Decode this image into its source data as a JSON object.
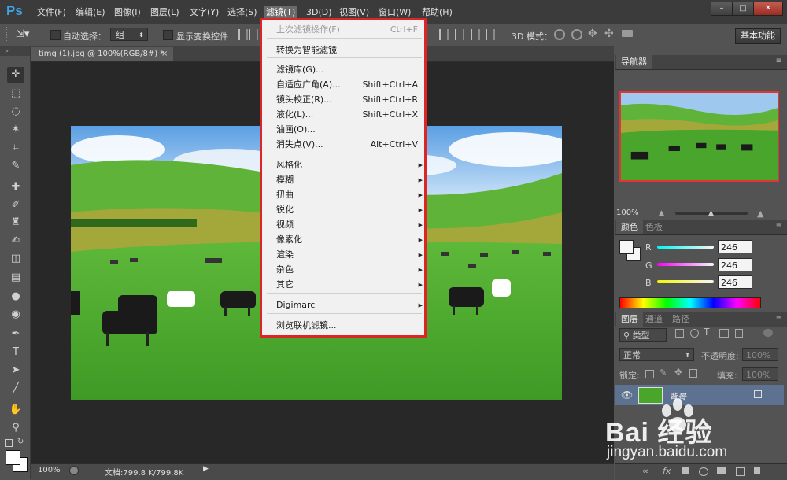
{
  "app": {
    "logo": "Ps"
  },
  "menubar": {
    "items": [
      "文件(F)",
      "编辑(E)",
      "图像(I)",
      "图层(L)",
      "文字(Y)",
      "选择(S)",
      "滤镜(T)",
      "3D(D)",
      "视图(V)",
      "窗口(W)",
      "帮助(H)"
    ],
    "active_index": 6
  },
  "window_controls": {
    "minimize": "–",
    "maximize": "□",
    "close": "✕"
  },
  "options_bar": {
    "auto_select_label": "自动选择：",
    "auto_select_value": "组",
    "show_transform_label": "显示变换控件",
    "mode_3d_label": "3D 模式：",
    "workspace_label": "基本功能"
  },
  "document": {
    "tab_title": "timg (1).jpg @ 100%(RGB/8#) *",
    "tab_close": "×"
  },
  "statusbar": {
    "zoom": "100%",
    "doc_info": "文档:799.8 K/799.8K"
  },
  "filter_menu": {
    "items": [
      {
        "label": "上次滤镜操作(F)",
        "shortcut": "Ctrl+F",
        "disabled": true
      },
      {
        "label": "转换为智能滤镜",
        "shortcut": ""
      },
      {
        "label": "滤镜库(G)...",
        "shortcut": ""
      },
      {
        "label": "自适应广角(A)...",
        "shortcut": "Shift+Ctrl+A"
      },
      {
        "label": "镜头校正(R)...",
        "shortcut": "Shift+Ctrl+R"
      },
      {
        "label": "液化(L)...",
        "shortcut": "Shift+Ctrl+X"
      },
      {
        "label": "油画(O)...",
        "shortcut": ""
      },
      {
        "label": "消失点(V)...",
        "shortcut": "Alt+Ctrl+V"
      },
      {
        "label": "风格化",
        "submenu": true
      },
      {
        "label": "模糊",
        "submenu": true
      },
      {
        "label": "扭曲",
        "submenu": true
      },
      {
        "label": "锐化",
        "submenu": true
      },
      {
        "label": "视频",
        "submenu": true
      },
      {
        "label": "像素化",
        "submenu": true
      },
      {
        "label": "渲染",
        "submenu": true
      },
      {
        "label": "杂色",
        "submenu": true
      },
      {
        "label": "其它",
        "submenu": true
      },
      {
        "label": "Digimarc",
        "submenu": true
      },
      {
        "label": "浏览联机滤镜...",
        "shortcut": ""
      }
    ]
  },
  "navigator": {
    "tab": "导航器",
    "zoom": "100%"
  },
  "color_panel": {
    "tabs": [
      "颜色",
      "色板"
    ],
    "channels": [
      {
        "label": "R",
        "value": "246"
      },
      {
        "label": "G",
        "value": "246"
      },
      {
        "label": "B",
        "value": "246"
      }
    ]
  },
  "layers_panel": {
    "tabs": [
      "图层",
      "通道",
      "路径"
    ],
    "filter_kind": "类型",
    "blend_mode": "正常",
    "opacity_label": "不透明度:",
    "opacity_value": "100%",
    "lock_label": "锁定:",
    "fill_label": "填充:",
    "fill_value": "100%",
    "layer_name": "背景",
    "footer_fx": "fx"
  },
  "watermark": {
    "brand": "Bai 经验",
    "url": "jingyan.baidu.com"
  },
  "colors": {
    "menu_highlight": "#dc2626",
    "selected_layer": "#5d7190"
  }
}
